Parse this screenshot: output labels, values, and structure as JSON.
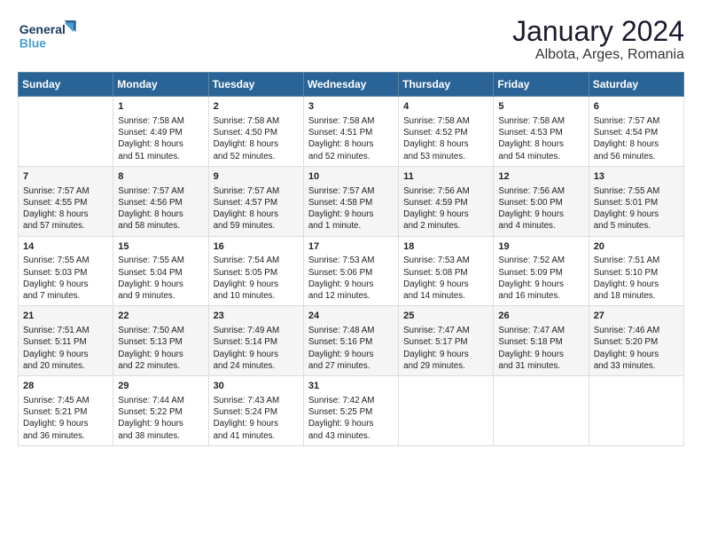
{
  "header": {
    "logo_line1": "General",
    "logo_line2": "Blue",
    "title": "January 2024",
    "subtitle": "Albota, Arges, Romania"
  },
  "days_of_week": [
    "Sunday",
    "Monday",
    "Tuesday",
    "Wednesday",
    "Thursday",
    "Friday",
    "Saturday"
  ],
  "weeks": [
    [
      {
        "day": "",
        "content": ""
      },
      {
        "day": "1",
        "content": "Sunrise: 7:58 AM\nSunset: 4:49 PM\nDaylight: 8 hours\nand 51 minutes."
      },
      {
        "day": "2",
        "content": "Sunrise: 7:58 AM\nSunset: 4:50 PM\nDaylight: 8 hours\nand 52 minutes."
      },
      {
        "day": "3",
        "content": "Sunrise: 7:58 AM\nSunset: 4:51 PM\nDaylight: 8 hours\nand 52 minutes."
      },
      {
        "day": "4",
        "content": "Sunrise: 7:58 AM\nSunset: 4:52 PM\nDaylight: 8 hours\nand 53 minutes."
      },
      {
        "day": "5",
        "content": "Sunrise: 7:58 AM\nSunset: 4:53 PM\nDaylight: 8 hours\nand 54 minutes."
      },
      {
        "day": "6",
        "content": "Sunrise: 7:57 AM\nSunset: 4:54 PM\nDaylight: 8 hours\nand 56 minutes."
      }
    ],
    [
      {
        "day": "7",
        "content": "Sunrise: 7:57 AM\nSunset: 4:55 PM\nDaylight: 8 hours\nand 57 minutes."
      },
      {
        "day": "8",
        "content": "Sunrise: 7:57 AM\nSunset: 4:56 PM\nDaylight: 8 hours\nand 58 minutes."
      },
      {
        "day": "9",
        "content": "Sunrise: 7:57 AM\nSunset: 4:57 PM\nDaylight: 8 hours\nand 59 minutes."
      },
      {
        "day": "10",
        "content": "Sunrise: 7:57 AM\nSunset: 4:58 PM\nDaylight: 9 hours\nand 1 minute."
      },
      {
        "day": "11",
        "content": "Sunrise: 7:56 AM\nSunset: 4:59 PM\nDaylight: 9 hours\nand 2 minutes."
      },
      {
        "day": "12",
        "content": "Sunrise: 7:56 AM\nSunset: 5:00 PM\nDaylight: 9 hours\nand 4 minutes."
      },
      {
        "day": "13",
        "content": "Sunrise: 7:55 AM\nSunset: 5:01 PM\nDaylight: 9 hours\nand 5 minutes."
      }
    ],
    [
      {
        "day": "14",
        "content": "Sunrise: 7:55 AM\nSunset: 5:03 PM\nDaylight: 9 hours\nand 7 minutes."
      },
      {
        "day": "15",
        "content": "Sunrise: 7:55 AM\nSunset: 5:04 PM\nDaylight: 9 hours\nand 9 minutes."
      },
      {
        "day": "16",
        "content": "Sunrise: 7:54 AM\nSunset: 5:05 PM\nDaylight: 9 hours\nand 10 minutes."
      },
      {
        "day": "17",
        "content": "Sunrise: 7:53 AM\nSunset: 5:06 PM\nDaylight: 9 hours\nand 12 minutes."
      },
      {
        "day": "18",
        "content": "Sunrise: 7:53 AM\nSunset: 5:08 PM\nDaylight: 9 hours\nand 14 minutes."
      },
      {
        "day": "19",
        "content": "Sunrise: 7:52 AM\nSunset: 5:09 PM\nDaylight: 9 hours\nand 16 minutes."
      },
      {
        "day": "20",
        "content": "Sunrise: 7:51 AM\nSunset: 5:10 PM\nDaylight: 9 hours\nand 18 minutes."
      }
    ],
    [
      {
        "day": "21",
        "content": "Sunrise: 7:51 AM\nSunset: 5:11 PM\nDaylight: 9 hours\nand 20 minutes."
      },
      {
        "day": "22",
        "content": "Sunrise: 7:50 AM\nSunset: 5:13 PM\nDaylight: 9 hours\nand 22 minutes."
      },
      {
        "day": "23",
        "content": "Sunrise: 7:49 AM\nSunset: 5:14 PM\nDaylight: 9 hours\nand 24 minutes."
      },
      {
        "day": "24",
        "content": "Sunrise: 7:48 AM\nSunset: 5:16 PM\nDaylight: 9 hours\nand 27 minutes."
      },
      {
        "day": "25",
        "content": "Sunrise: 7:47 AM\nSunset: 5:17 PM\nDaylight: 9 hours\nand 29 minutes."
      },
      {
        "day": "26",
        "content": "Sunrise: 7:47 AM\nSunset: 5:18 PM\nDaylight: 9 hours\nand 31 minutes."
      },
      {
        "day": "27",
        "content": "Sunrise: 7:46 AM\nSunset: 5:20 PM\nDaylight: 9 hours\nand 33 minutes."
      }
    ],
    [
      {
        "day": "28",
        "content": "Sunrise: 7:45 AM\nSunset: 5:21 PM\nDaylight: 9 hours\nand 36 minutes."
      },
      {
        "day": "29",
        "content": "Sunrise: 7:44 AM\nSunset: 5:22 PM\nDaylight: 9 hours\nand 38 minutes."
      },
      {
        "day": "30",
        "content": "Sunrise: 7:43 AM\nSunset: 5:24 PM\nDaylight: 9 hours\nand 41 minutes."
      },
      {
        "day": "31",
        "content": "Sunrise: 7:42 AM\nSunset: 5:25 PM\nDaylight: 9 hours\nand 43 minutes."
      },
      {
        "day": "",
        "content": ""
      },
      {
        "day": "",
        "content": ""
      },
      {
        "day": "",
        "content": ""
      }
    ]
  ]
}
